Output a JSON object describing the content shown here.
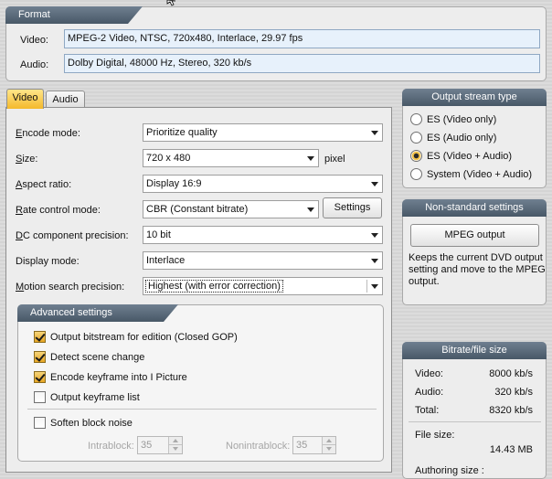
{
  "format": {
    "header": "Format",
    "video_label": "Video:",
    "video_value": "MPEG-2 Video, NTSC, 720x480, Interlace, 29.97 fps",
    "audio_label": "Audio:",
    "audio_value": "Dolby Digital, 48000  Hz, Stereo, 320 kb/s"
  },
  "tabs": [
    {
      "label": "Video",
      "active": true
    },
    {
      "label": "Audio",
      "active": false
    }
  ],
  "video_settings": {
    "encode_mode": {
      "label_pre": "",
      "label_u": "E",
      "label_post": "ncode mode:",
      "value": "Prioritize quality"
    },
    "size": {
      "label_pre": "",
      "label_u": "S",
      "label_post": "ize:",
      "value": "720 x 480",
      "unit": "pixel"
    },
    "aspect_ratio": {
      "label_pre": "",
      "label_u": "A",
      "label_post": "spect ratio:",
      "value": "Display 16:9"
    },
    "rate_control": {
      "label_pre": "",
      "label_u": "R",
      "label_post": "ate control mode:",
      "value": "CBR (Constant bitrate)",
      "settings_label": "Settings"
    },
    "dc_precision": {
      "label_pre": "",
      "label_u": "D",
      "label_post": "C component precision:",
      "value": "10 bit"
    },
    "display_mode": {
      "label_pre": "Display mode:",
      "label_u": "",
      "label_post": "",
      "value": "Interlace"
    },
    "motion_search": {
      "label_pre": "",
      "label_u": "M",
      "label_post": "otion search precision:",
      "value": "Highest (with error correction)"
    }
  },
  "advanced": {
    "header": "Advanced settings",
    "items": [
      {
        "label": "Output bitstream for edition (Closed GOP)",
        "checked": true
      },
      {
        "label": "Detect scene change",
        "checked": true
      },
      {
        "label": "Encode keyframe into I Picture",
        "checked": true
      },
      {
        "label": "Output keyframe list",
        "checked": false
      }
    ],
    "soften": {
      "label": "Soften block noise",
      "checked": false
    },
    "intrablock": {
      "label": "Intrablock:",
      "value": "35"
    },
    "nonintrablock": {
      "label": "Nonintrablock:",
      "value": "35"
    }
  },
  "output_stream": {
    "header": "Output stream type",
    "options": [
      {
        "label": "ES (Video only)",
        "selected": false
      },
      {
        "label": "ES (Audio only)",
        "selected": false
      },
      {
        "label": "ES (Video + Audio)",
        "selected": true
      },
      {
        "label": "System (Video + Audio)",
        "selected": false
      }
    ]
  },
  "nonstandard": {
    "header": "Non-standard settings",
    "button_label": "MPEG output",
    "description_lines": [
      "Keeps the current DVD output",
      "setting and move to the MPEG",
      "output."
    ]
  },
  "bitrate": {
    "header": "Bitrate/file size",
    "video_label": "Video:",
    "video_value": "8000 kb/s",
    "audio_label": "Audio:",
    "audio_value": "320 kb/s",
    "total_label": "Total:",
    "total_value": "8320 kb/s",
    "filesize_label": "File size:",
    "filesize_value": "14.43 MB",
    "authoring_label": "Authoring size :"
  },
  "colors": {
    "header_bg": "#485867",
    "tab_active": "#f4b92b",
    "field_bg": "#e7f1fb"
  }
}
